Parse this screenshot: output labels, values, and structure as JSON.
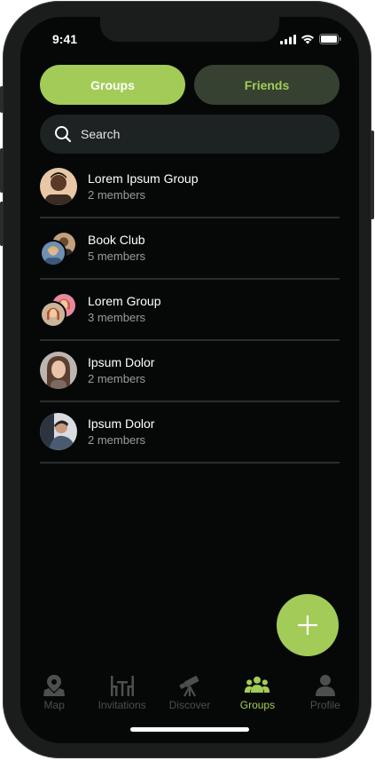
{
  "status_bar": {
    "time": "9:41"
  },
  "segments": {
    "groups_label": "Groups",
    "friends_label": "Friends",
    "active": "groups"
  },
  "search": {
    "placeholder": "Search",
    "value": ""
  },
  "groups": [
    {
      "name": "Lorem Ipsum Group",
      "members": "2 members"
    },
    {
      "name": "Book Club",
      "members": "5 members"
    },
    {
      "name": "Lorem Group",
      "members": "3 members"
    },
    {
      "name": "Ipsum Dolor",
      "members": "2 members"
    },
    {
      "name": "Ipsum Dolor",
      "members": "2 members"
    }
  ],
  "fab": {
    "icon": "plus-icon"
  },
  "tabbar": {
    "items": [
      {
        "label": "Map",
        "icon": "map-pin-icon"
      },
      {
        "label": "Invitations",
        "icon": "table-chairs-icon"
      },
      {
        "label": "Discover",
        "icon": "telescope-icon"
      },
      {
        "label": "Groups",
        "icon": "people-group-icon"
      },
      {
        "label": "Profile",
        "icon": "person-icon"
      }
    ],
    "active": "Groups"
  },
  "colors": {
    "accent": "#a2cc57",
    "background": "#060808",
    "inactive_tab": "#4b4f4e",
    "friends_segment": "#364131"
  }
}
